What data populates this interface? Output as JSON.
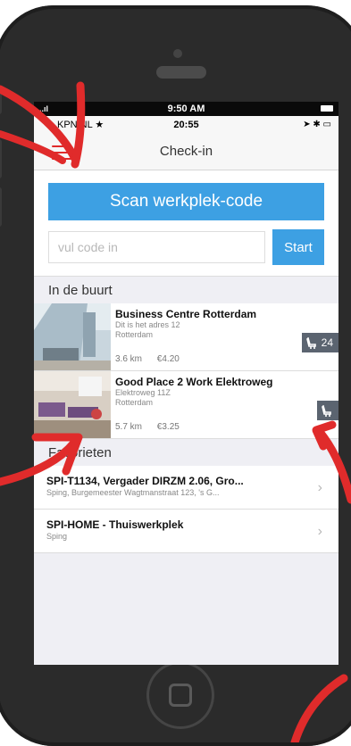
{
  "status_outer": {
    "left": "..ıl",
    "time": "9:50 AM"
  },
  "status_inner": {
    "carrier": "KPN NL ★",
    "time": "20:55",
    "icons": "➤ ✱ ▭"
  },
  "navbar": {
    "title": "Check-in"
  },
  "scan": {
    "button_label": "Scan werkplek-code",
    "code_placeholder": "vul code in",
    "start_label": "Start"
  },
  "nearby": {
    "header": "In de buurt",
    "places": [
      {
        "name": "Business Centre Rotterdam",
        "address": "Dit is het adres 12",
        "city": "Rotterdam",
        "distance": "3.6 km",
        "price": "€4.20",
        "seats": "24"
      },
      {
        "name": "Good Place 2 Work Elektroweg",
        "address": "Elektroweg 11Z",
        "city": "Rotterdam",
        "distance": "5.7 km",
        "price": "€3.25",
        "seats": ""
      }
    ]
  },
  "favorites": {
    "header": "Favorieten",
    "items": [
      {
        "title": "SPI-T1134, Vergader DIRZM 2.06, Gro...",
        "subtitle": "Sping, Burgemeester Wagtmanstraat 123, 's G..."
      },
      {
        "title": "SPI-HOME - Thuiswerkplek",
        "subtitle": "Sping"
      }
    ]
  },
  "colors": {
    "accent": "#3da0e3",
    "annotation": "#e02b2b",
    "badge": "#5b6470"
  }
}
